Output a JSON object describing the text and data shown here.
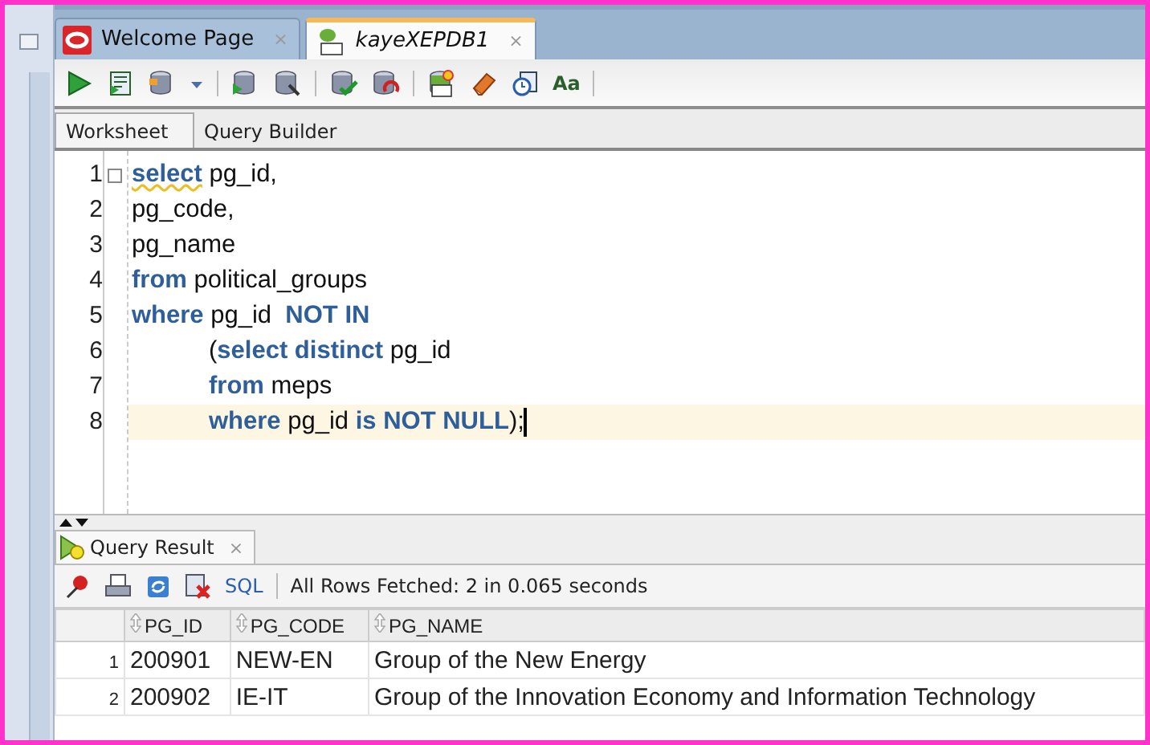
{
  "doc_tabs": [
    {
      "label": "Welcome Page",
      "kind": "oracle",
      "selected": false,
      "close": "×"
    },
    {
      "label": "kayeXEPDB1",
      "kind": "sql",
      "selected": true,
      "close": "×"
    }
  ],
  "toolbar": [
    {
      "kind": "run"
    },
    {
      "kind": "script"
    },
    {
      "kind": "tree"
    },
    {
      "kind": "caret"
    },
    {
      "kind": "sep"
    },
    {
      "kind": "tree-run"
    },
    {
      "kind": "db-wrench"
    },
    {
      "kind": "sep"
    },
    {
      "kind": "db-check"
    },
    {
      "kind": "db-undo"
    },
    {
      "kind": "sep"
    },
    {
      "kind": "sql"
    },
    {
      "kind": "eraser"
    },
    {
      "kind": "clock"
    },
    {
      "kind": "text",
      "glyph": "Aa"
    },
    {
      "kind": "sep"
    }
  ],
  "sub_tabs": [
    {
      "label": "Worksheet",
      "selected": true
    },
    {
      "label": "Query Builder",
      "selected": false
    }
  ],
  "editor": {
    "lines": [
      {
        "number": "1",
        "indented": false,
        "current": false,
        "segments": [
          {
            "text": "select",
            "kind": "keyword",
            "flagged": true
          },
          {
            "text": " pg_id,",
            "kind": "plain",
            "flagged": false
          }
        ]
      },
      {
        "number": "2",
        "indented": false,
        "current": false,
        "segments": [
          {
            "text": "pg_code,",
            "kind": "plain",
            "flagged": false
          }
        ]
      },
      {
        "number": "3",
        "indented": false,
        "current": false,
        "segments": [
          {
            "text": "pg_name",
            "kind": "plain",
            "flagged": false
          }
        ]
      },
      {
        "number": "4",
        "indented": false,
        "current": false,
        "segments": [
          {
            "text": "from",
            "kind": "keyword",
            "flagged": false
          },
          {
            "text": " political_groups",
            "kind": "plain",
            "flagged": false
          }
        ]
      },
      {
        "number": "5",
        "indented": false,
        "current": false,
        "segments": [
          {
            "text": "where",
            "kind": "keyword",
            "flagged": false
          },
          {
            "text": " pg_id  ",
            "kind": "plain",
            "flagged": false
          },
          {
            "text": "NOT IN",
            "kind": "keyword",
            "flagged": false
          }
        ]
      },
      {
        "number": "6",
        "indented": true,
        "current": false,
        "segments": [
          {
            "text": "(",
            "kind": "plain",
            "flagged": false
          },
          {
            "text": "select distinct",
            "kind": "keyword",
            "flagged": false
          },
          {
            "text": " pg_id",
            "kind": "plain",
            "flagged": false
          }
        ]
      },
      {
        "number": "7",
        "indented": true,
        "current": false,
        "segments": [
          {
            "text": "from",
            "kind": "keyword",
            "flagged": false
          },
          {
            "text": " meps",
            "kind": "plain",
            "flagged": false
          }
        ]
      },
      {
        "number": "8",
        "indented": true,
        "current": true,
        "segments": [
          {
            "text": "where",
            "kind": "keyword",
            "flagged": false
          },
          {
            "text": " pg_id ",
            "kind": "plain",
            "flagged": false
          },
          {
            "text": "is NOT NULL",
            "kind": "keyword",
            "flagged": false
          },
          {
            "text": ");",
            "kind": "plain",
            "flagged": false
          }
        ]
      }
    ]
  },
  "result_panel": {
    "tab": {
      "label": "Query Result",
      "close": "×"
    },
    "toolbar": [
      {
        "kind": "pin"
      },
      {
        "kind": "print"
      },
      {
        "kind": "refresh"
      },
      {
        "kind": "delete"
      }
    ],
    "sql_link": "SQL",
    "status": "All Rows Fetched: 2 in 0.065 seconds",
    "table": {
      "columns": [
        "PG_ID",
        "PG_CODE",
        "PG_NAME"
      ],
      "rows": [
        {
          "number": "1",
          "cells": [
            "200901",
            "NEW-EN",
            "Group of the New Energy"
          ]
        },
        {
          "number": "2",
          "cells": [
            "200902",
            "IE-IT",
            "Group of the Innovation Economy and Information Technology"
          ]
        }
      ]
    }
  }
}
